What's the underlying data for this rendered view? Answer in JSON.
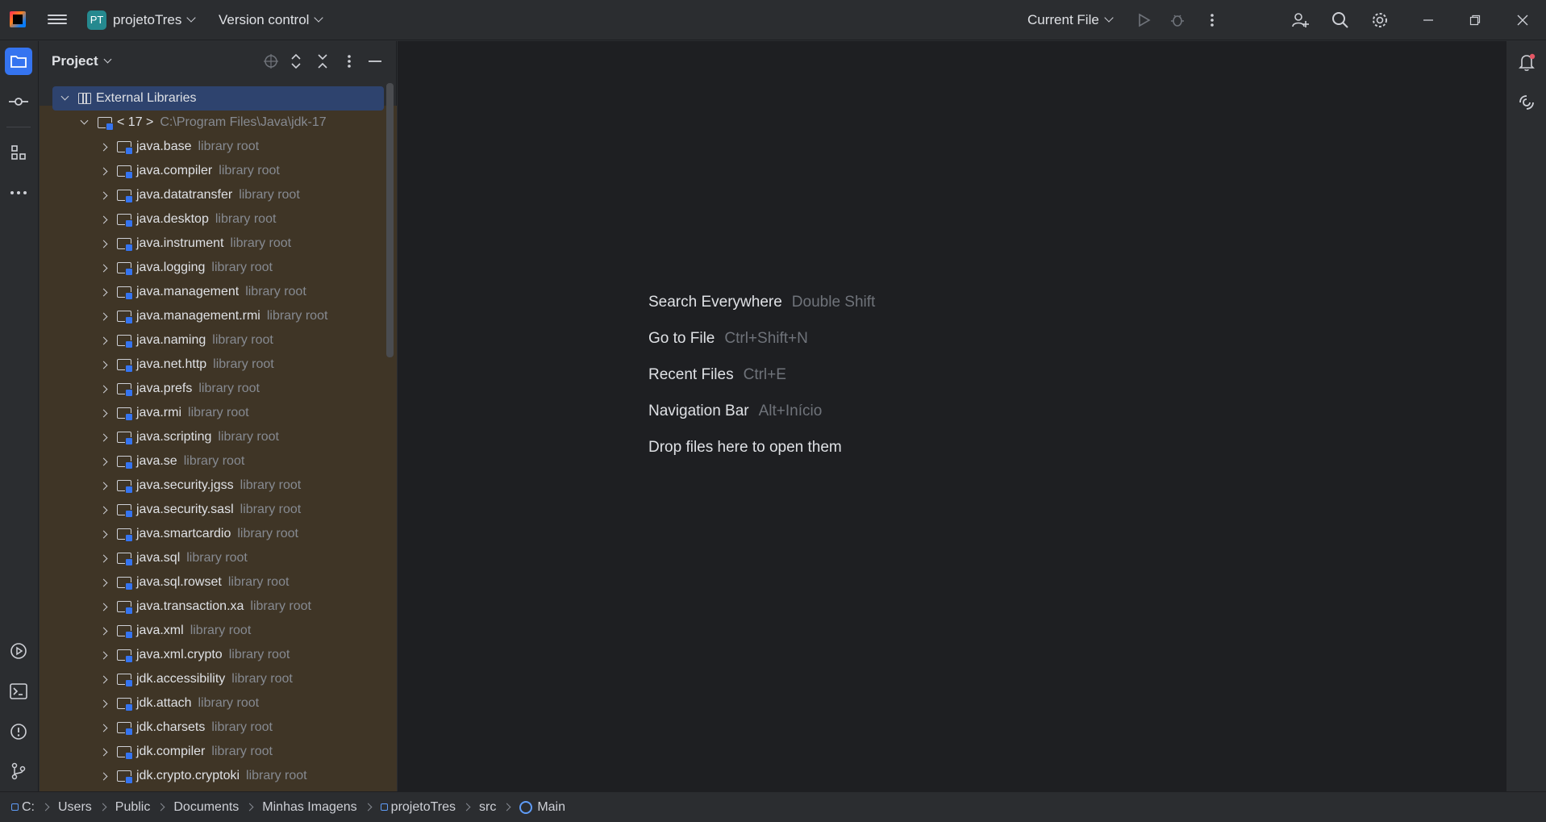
{
  "titlebar": {
    "project_badge": "PT",
    "project_name": "projetoTres",
    "version_control": "Version control",
    "run_config": "Current File"
  },
  "project_panel": {
    "title": "Project",
    "tree": {
      "root": {
        "label": "External Libraries"
      },
      "jdk": {
        "label": "< 17 >",
        "path": "C:\\Program Files\\Java\\jdk-17"
      },
      "modules": [
        {
          "name": "java.base",
          "hint": "library root"
        },
        {
          "name": "java.compiler",
          "hint": "library root"
        },
        {
          "name": "java.datatransfer",
          "hint": "library root"
        },
        {
          "name": "java.desktop",
          "hint": "library root"
        },
        {
          "name": "java.instrument",
          "hint": "library root"
        },
        {
          "name": "java.logging",
          "hint": "library root"
        },
        {
          "name": "java.management",
          "hint": "library root"
        },
        {
          "name": "java.management.rmi",
          "hint": "library root"
        },
        {
          "name": "java.naming",
          "hint": "library root"
        },
        {
          "name": "java.net.http",
          "hint": "library root"
        },
        {
          "name": "java.prefs",
          "hint": "library root"
        },
        {
          "name": "java.rmi",
          "hint": "library root"
        },
        {
          "name": "java.scripting",
          "hint": "library root"
        },
        {
          "name": "java.se",
          "hint": "library root"
        },
        {
          "name": "java.security.jgss",
          "hint": "library root"
        },
        {
          "name": "java.security.sasl",
          "hint": "library root"
        },
        {
          "name": "java.smartcardio",
          "hint": "library root"
        },
        {
          "name": "java.sql",
          "hint": "library root"
        },
        {
          "name": "java.sql.rowset",
          "hint": "library root"
        },
        {
          "name": "java.transaction.xa",
          "hint": "library root"
        },
        {
          "name": "java.xml",
          "hint": "library root"
        },
        {
          "name": "java.xml.crypto",
          "hint": "library root"
        },
        {
          "name": "jdk.accessibility",
          "hint": "library root"
        },
        {
          "name": "jdk.attach",
          "hint": "library root"
        },
        {
          "name": "jdk.charsets",
          "hint": "library root"
        },
        {
          "name": "jdk.compiler",
          "hint": "library root"
        },
        {
          "name": "jdk.crypto.cryptoki",
          "hint": "library root"
        }
      ]
    }
  },
  "editor": {
    "hints": [
      {
        "label": "Search Everywhere",
        "shortcut": "Double Shift"
      },
      {
        "label": "Go to File",
        "shortcut": "Ctrl+Shift+N"
      },
      {
        "label": "Recent Files",
        "shortcut": "Ctrl+E"
      },
      {
        "label": "Navigation Bar",
        "shortcut": "Alt+Início"
      },
      {
        "label": "Drop files here to open them",
        "shortcut": ""
      }
    ]
  },
  "breadcrumbs": [
    "C:",
    "Users",
    "Public",
    "Documents",
    "Minhas Imagens",
    "projetoTres",
    "src",
    "Main"
  ],
  "colors": {
    "accent": "#3574f0",
    "selection": "#2e436e",
    "library_bg": "#3f3526",
    "editor_bg": "#1e1f22"
  }
}
